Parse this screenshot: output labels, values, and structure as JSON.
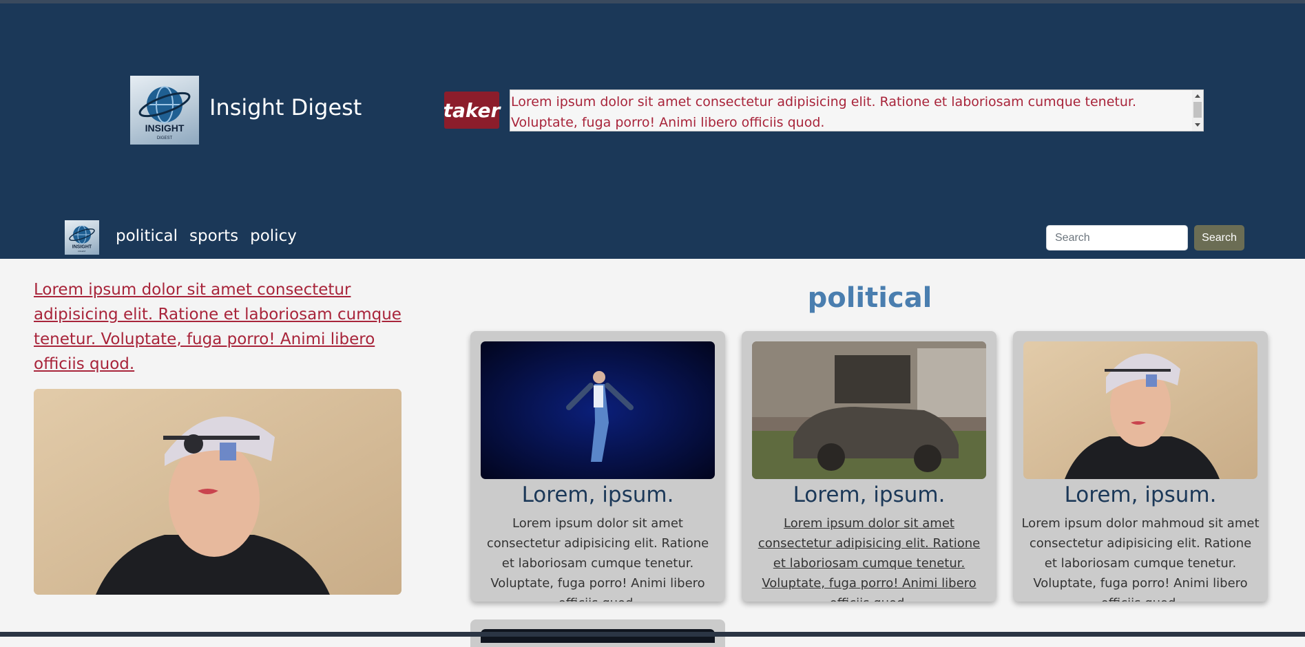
{
  "header": {
    "brand_title": "Insight Digest",
    "logo_text_main": "INSIGHT",
    "logo_text_sub": "DIGEST",
    "ticker_label": "taker",
    "ticker_text": "Lorem ipsum dolor sit amet consectetur adipisicing elit. Ratione et laboriosam cumque tenetur. Voluptate, fuga porro! Animi libero officiis quod."
  },
  "nav": {
    "links": [
      "political",
      "sports",
      "policy"
    ],
    "search_placeholder": "Search",
    "search_button": "Search"
  },
  "feature": {
    "headline": "Lorem ipsum dolor sit amet consectetur adipisicing elit. Ratione et laboriosam cumque tenetur. Voluptate, fuga porro! Animi libero officiis quod."
  },
  "section": {
    "title": "political",
    "cards": [
      {
        "title": "Lorem, ipsum.",
        "text": "Lorem ipsum dolor sit amet consectetur adipisicing elit. Ratione et laboriosam cumque tenetur. Voluptate, fuga porro! Animi libero officiis quod."
      },
      {
        "title": "Lorem, ipsum.",
        "text": "Lorem ipsum dolor sit amet consectetur adipisicing elit. Ratione et laboriosam cumque tenetur. Voluptate, fuga porro! Animi libero officiis quod."
      },
      {
        "title": "Lorem, ipsum.",
        "text": "Lorem ipsum dolor mahmoud sit amet consectetur adipisicing elit. Ratione et laboriosam cumque tenetur. Voluptate, fuga porro! Animi libero officiis quod."
      }
    ]
  },
  "colors": {
    "header_bg": "#1b3858",
    "accent_red": "#a8243a",
    "ticker_badge": "#8c1d2b",
    "section_title": "#4a7eaf",
    "search_button": "#6b6d54",
    "card_bg": "#cbcbcb"
  },
  "icons": {
    "logo": "globe-logo-icon",
    "ticker_scroll_up": "arrow-up-icon",
    "ticker_scroll_down": "arrow-down-icon"
  }
}
